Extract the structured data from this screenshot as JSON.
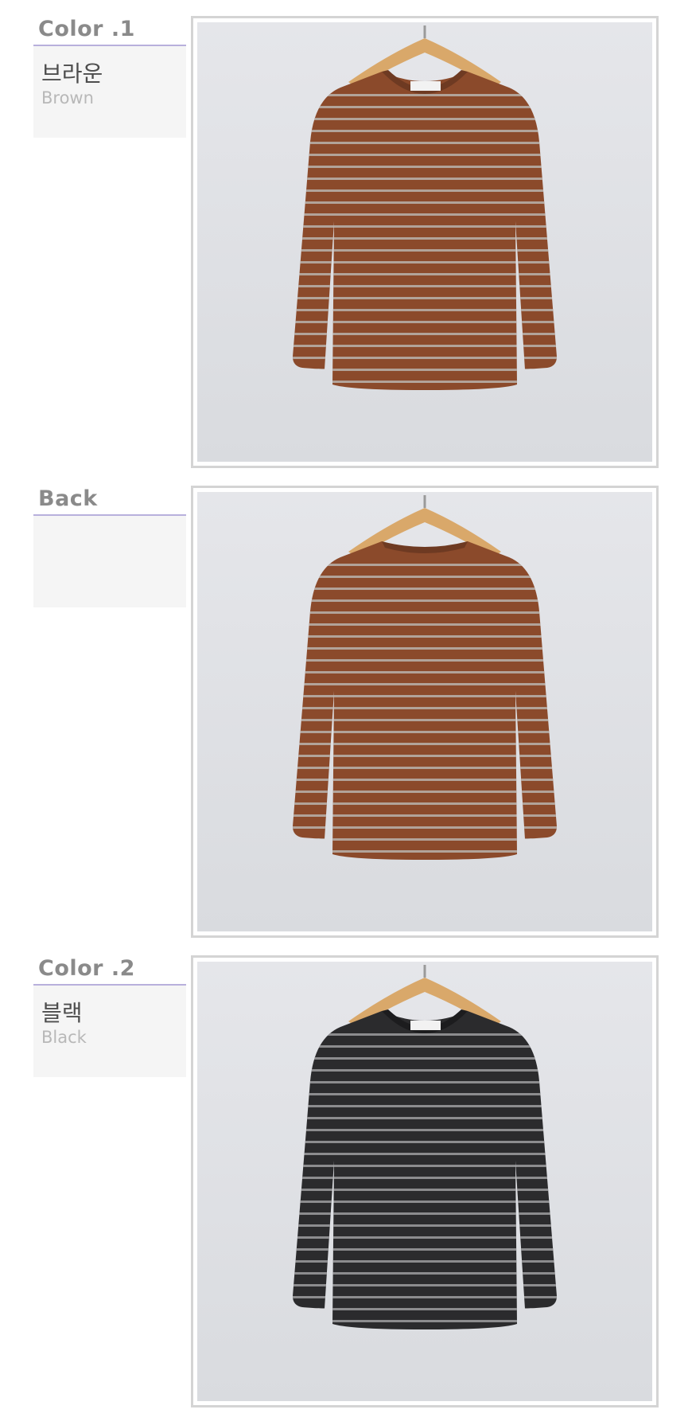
{
  "sections": [
    {
      "heading": "Color .1",
      "name_ko": "브라운",
      "name_en": "Brown",
      "garment_color": "#8b4a2b",
      "stripe_color": "#b9b3ad",
      "collar_color": "#6e3a22"
    },
    {
      "heading": "Back",
      "name_ko": "",
      "name_en": "",
      "garment_color": "#8b4a2b",
      "stripe_color": "#b9b3ad",
      "collar_color": "#6e3a22"
    },
    {
      "heading": "Color .2",
      "name_ko": "블랙",
      "name_en": "Black",
      "garment_color": "#2b2b2d",
      "stripe_color": "#9d9da0",
      "collar_color": "#1c1c1e"
    }
  ],
  "colors": {
    "heading_underline": "#b8b0dc",
    "label_bg": "#f5f5f5",
    "frame_border": "#d4d4d4"
  }
}
